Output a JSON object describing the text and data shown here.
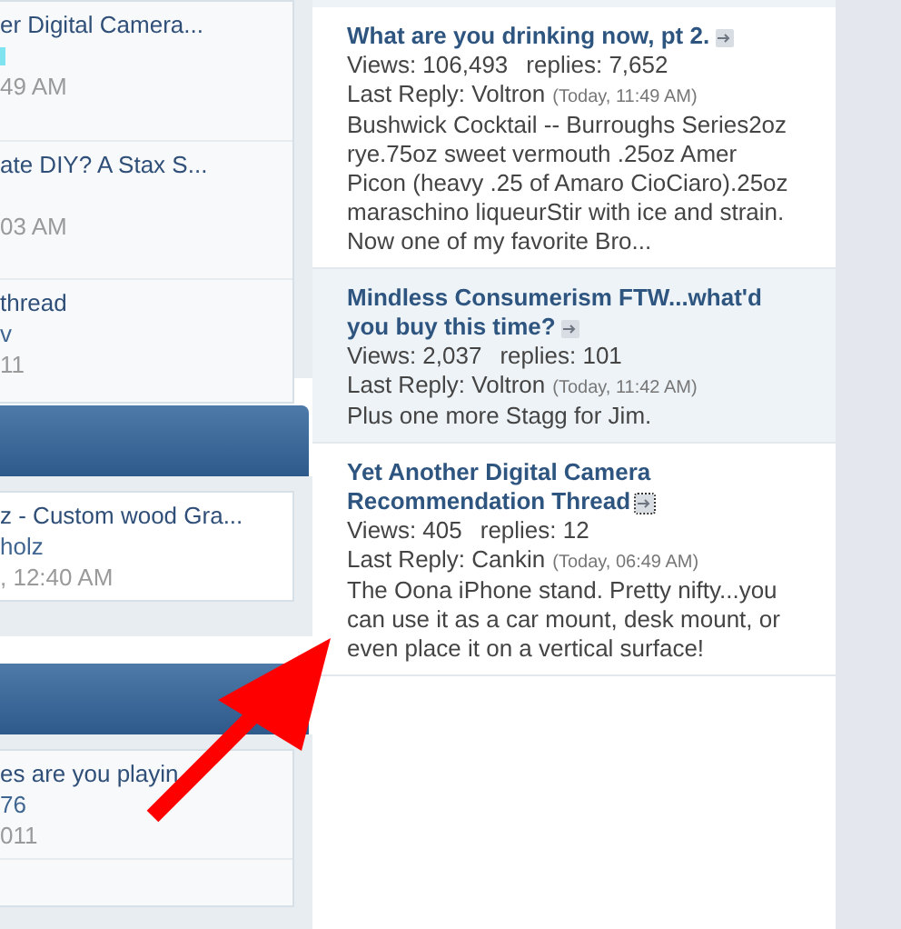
{
  "sidebar": {
    "panels": [
      {
        "header": false,
        "rows": [
          {
            "lines": [
              {
                "kind": "title",
                "text": "er Digital Camera..."
              },
              {
                "kind": "mark"
              },
              {
                "kind": "time",
                "text": "49 AM"
              }
            ]
          },
          {
            "lines": [
              {
                "kind": "title",
                "text": "ate DIY? A Stax S..."
              },
              {
                "kind": "gap"
              },
              {
                "kind": "time",
                "text": "03 AM"
              }
            ]
          },
          {
            "lines": [
              {
                "kind": "title",
                "text": " thread"
              },
              {
                "kind": "user",
                "text": "v"
              },
              {
                "kind": "time",
                "text": "11"
              }
            ]
          }
        ]
      },
      {
        "header": true,
        "rows": [
          {
            "lines": [
              {
                "kind": "title",
                "text": "z - Custom wood Gra..."
              },
              {
                "kind": "user",
                "text": "holz"
              },
              {
                "kind": "time",
                "text": ", 12:40 AM"
              }
            ]
          }
        ]
      },
      {
        "header": true,
        "rows": [
          {
            "lines": [
              {
                "kind": "title",
                "text": "es are you playin"
              },
              {
                "kind": "user",
                "text": "76"
              },
              {
                "kind": "time",
                "text": "011"
              }
            ]
          },
          {
            "lines": [
              {
                "kind": "gap"
              }
            ]
          }
        ]
      }
    ]
  },
  "threads": [
    {
      "title": "What are you drinking now, pt 2.",
      "focused": false,
      "views": "Views: 106,493",
      "replies": "replies: 7,652",
      "last_reply": "Last Reply: Voltron",
      "time": "(Today, 11:49 AM)",
      "preview": "Bushwick Cocktail -- Burroughs Series2oz rye.75oz sweet vermouth .25oz Amer Picon (heavy .25 of Amaro CioCiaro).25oz maraschino liqueurStir with ice and strain. Now one of my favorite Bro..."
    },
    {
      "title": "Mindless Consumerism FTW...what'd you buy this time?",
      "focused": false,
      "views": "Views: 2,037",
      "replies": "replies: 101",
      "last_reply": "Last Reply: Voltron",
      "time": "(Today, 11:42 AM)",
      "preview": "Plus one more Stagg for Jim."
    },
    {
      "title": "Yet Another Digital Camera Recommendation Thread",
      "focused": true,
      "views": "Views: 405",
      "replies": "replies: 12",
      "last_reply": "Last Reply: Cankin",
      "time": "(Today, 06:49 AM)",
      "preview": "The Oona iPhone stand. Pretty nifty...you can use it as a car mount, desk mount, or even place it on a vertical surface!"
    }
  ]
}
